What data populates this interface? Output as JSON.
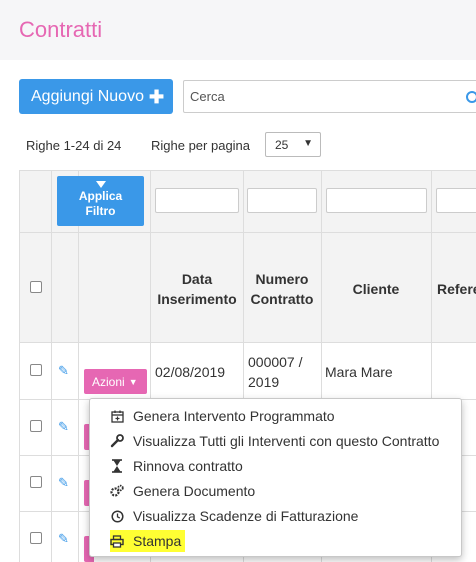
{
  "page": {
    "title": "Contratti"
  },
  "toolbar": {
    "add_label": "Aggiungi Nuovo",
    "add_icon": "plus-icon"
  },
  "search": {
    "placeholder": "Cerca"
  },
  "pagination": {
    "rows_info": "Righe 1-24 di 24",
    "rows_per_page_label": "Righe per pagina",
    "rows_per_page_value": "25"
  },
  "filter": {
    "apply_label": "Applica Filtro"
  },
  "table": {
    "columns": [
      "Data Inserimento",
      "Numero Contratto",
      "Cliente",
      "Refere"
    ],
    "rows": [
      {
        "data": "02/08/2019",
        "numero": "000007 / 2019",
        "cliente": "Mara Mare",
        "actions_label": "Azioni"
      }
    ]
  },
  "actions_menu": {
    "items": [
      {
        "label": "Genera Intervento Programmato",
        "icon": "calendar-plus-icon"
      },
      {
        "label": "Visualizza Tutti gli Interventi con questo Contratto",
        "icon": "wrench-icon"
      },
      {
        "label": "Rinnova contratto",
        "icon": "hourglass-icon"
      },
      {
        "label": "Genera Documento",
        "icon": "gears-icon"
      },
      {
        "label": "Visualizza Scadenze di Fatturazione",
        "icon": "clock-icon"
      },
      {
        "label": "Stampa",
        "icon": "printer-icon",
        "highlighted": true
      }
    ]
  },
  "colors": {
    "accent_pink": "#e667b3",
    "primary_blue": "#3a98e8",
    "highlight": "#ffff33"
  }
}
